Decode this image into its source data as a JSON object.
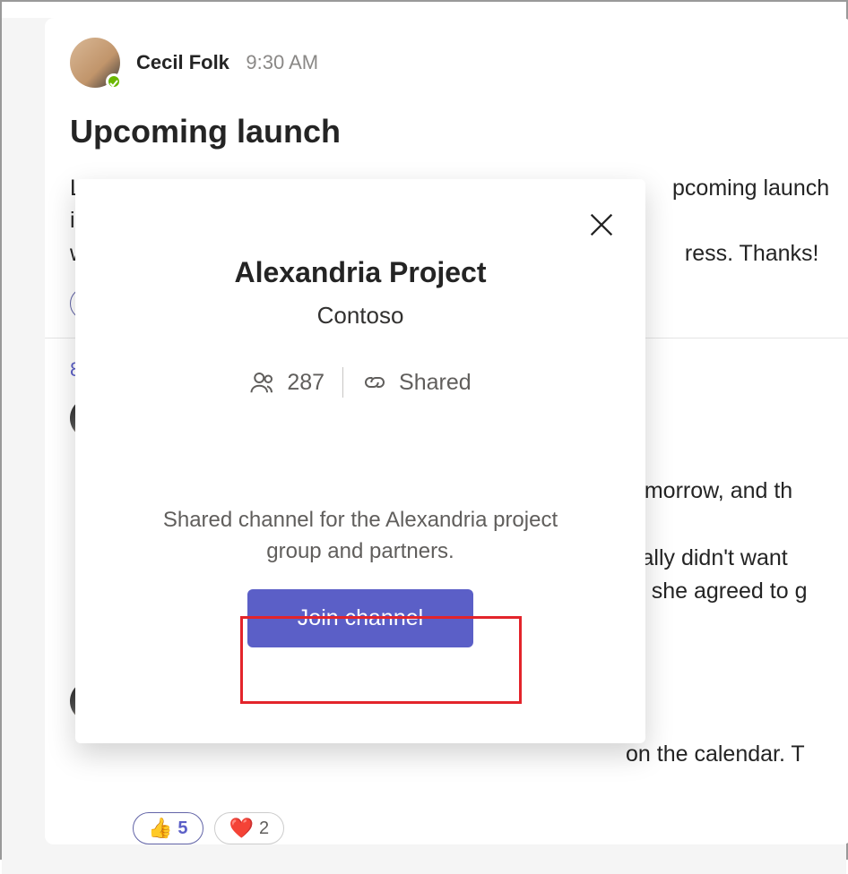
{
  "post": {
    "author": "Cecil Folk",
    "timestamp": "9:30 AM",
    "title": "Upcoming launch",
    "body": "Let's                                                                        pcoming launch is wee                                                                         ress. Thanks!",
    "replies_label": "8 rep"
  },
  "reactions": {
    "top": {
      "emoji": "👍",
      "count": ""
    },
    "bottom1": {
      "emoji": "👍",
      "count": "5"
    },
    "bottom2": {
      "emoji": "❤️",
      "count": "2"
    }
  },
  "reply1": {
    "text": "tomorrow, and th initially didn't want nt, she agreed to g"
  },
  "reply2": {
    "text": "on the calendar. T"
  },
  "modal": {
    "title": "Alexandria Project",
    "subtitle": "Contoso",
    "member_count": "287",
    "shared_label": "Shared",
    "description": "Shared channel for the Alexandria project group and partners.",
    "join_label": "Join channel"
  }
}
